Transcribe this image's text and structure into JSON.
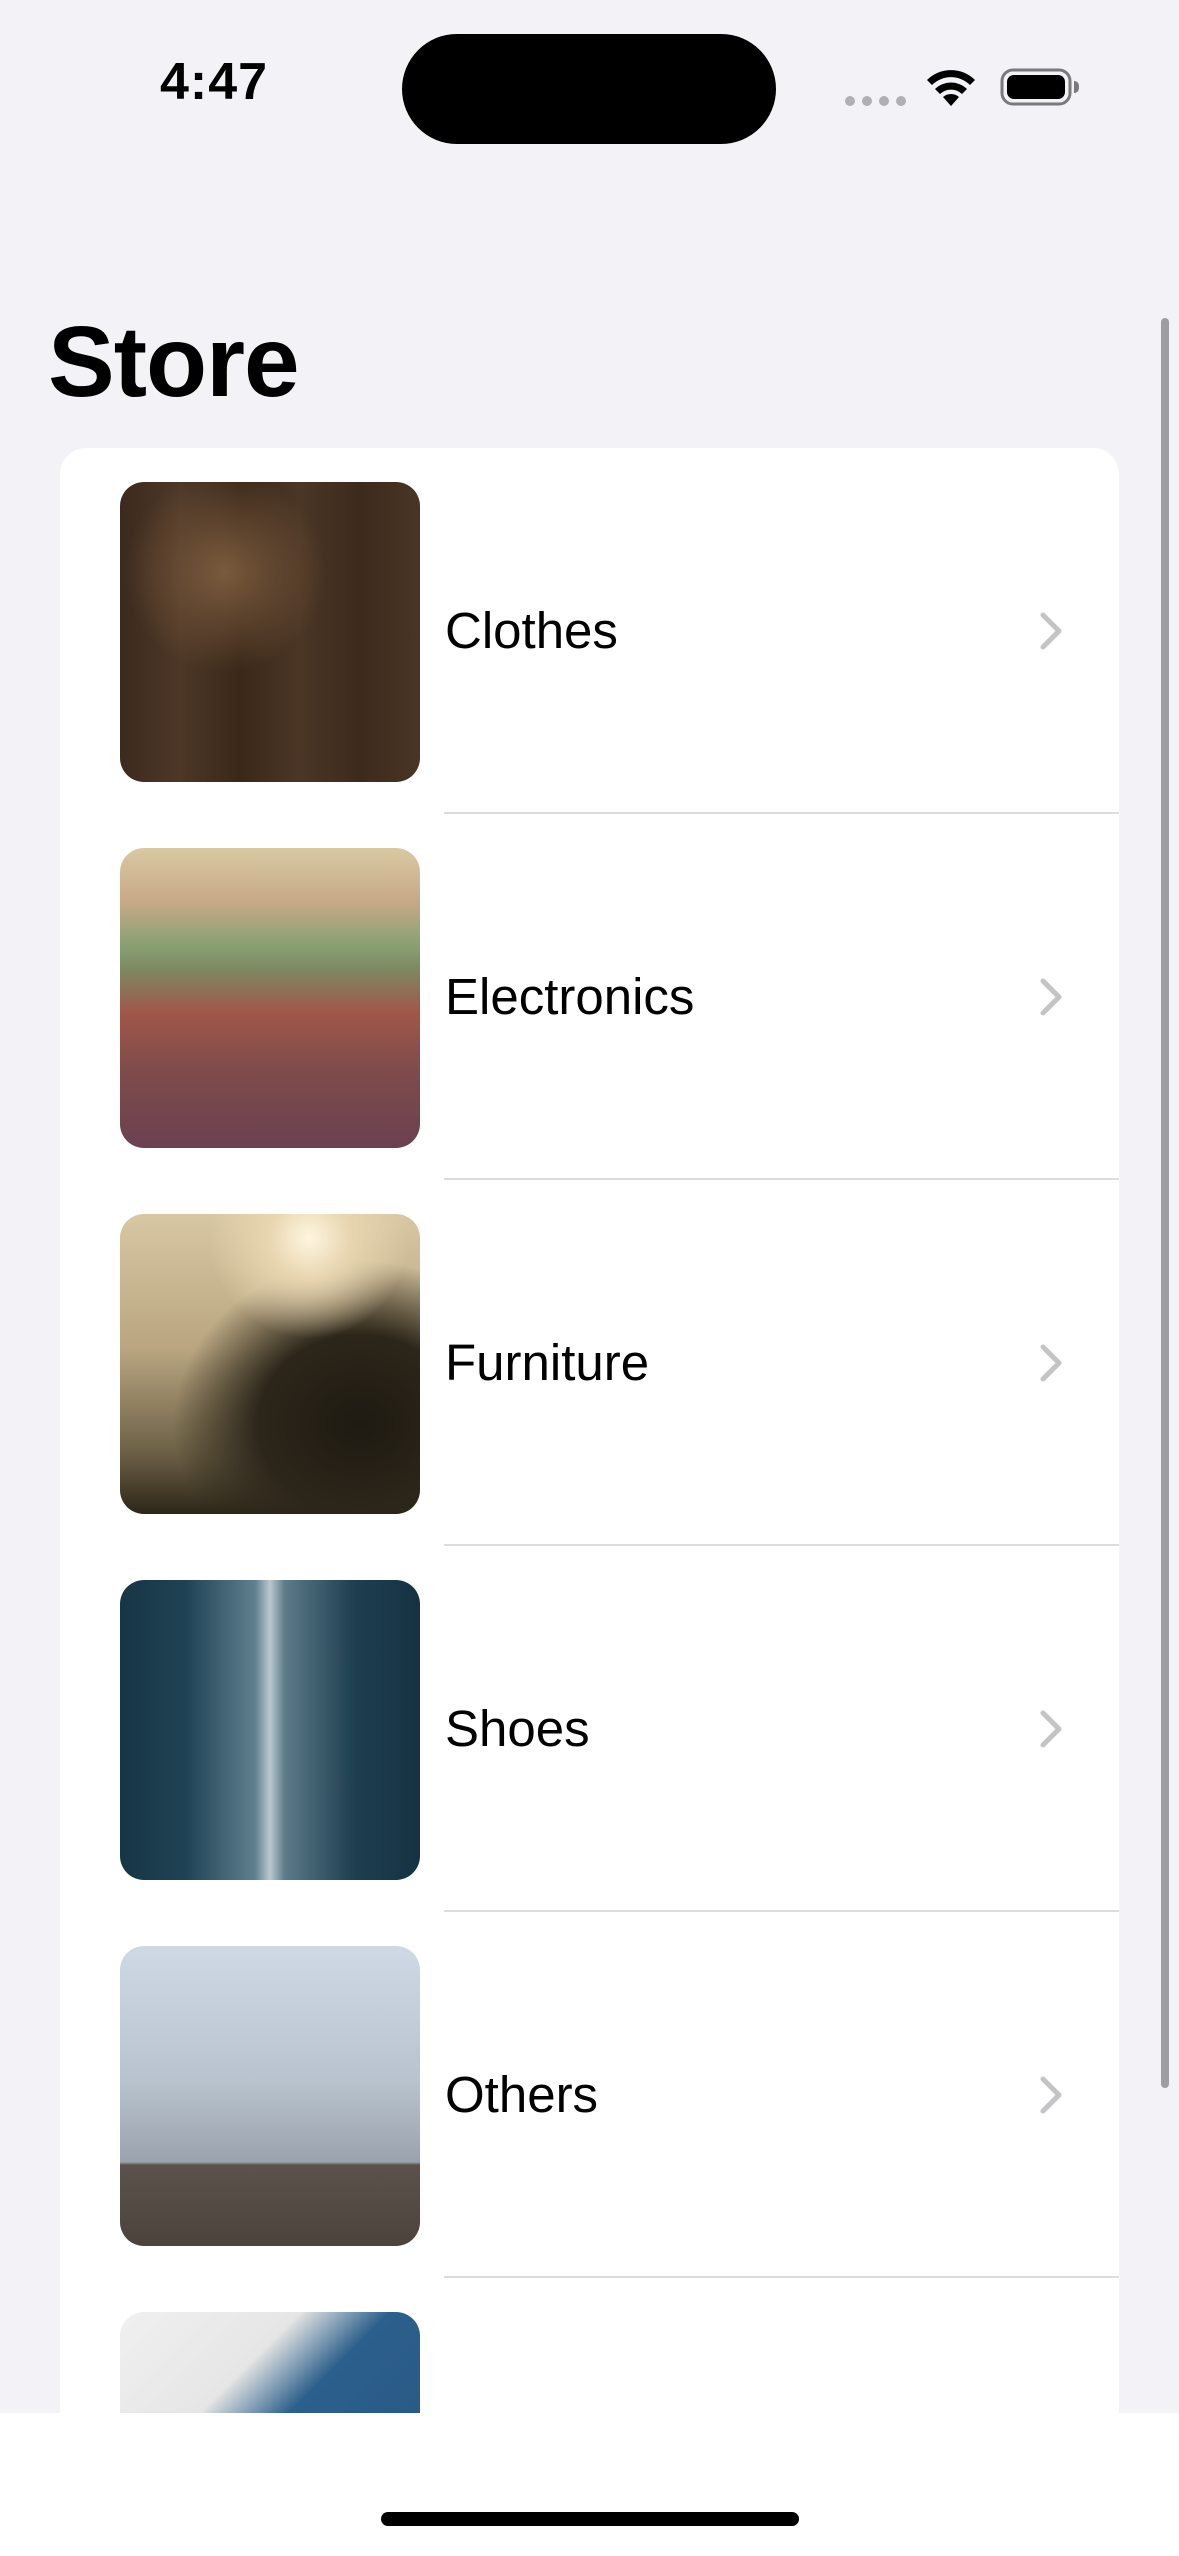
{
  "status_bar": {
    "time": "4:47",
    "icons": [
      "cellular-signal-icon",
      "wifi-icon",
      "battery-icon"
    ]
  },
  "page": {
    "title": "Store"
  },
  "categories": [
    {
      "label": "Clothes",
      "image": "tools-on-wood-photo"
    },
    {
      "label": "Electronics",
      "image": "autumn-leaves-path-photo"
    },
    {
      "label": "Furniture",
      "image": "foggy-tree-photo"
    },
    {
      "label": "Shoes",
      "image": "city-street-photo"
    },
    {
      "label": "Others",
      "image": "foggy-pier-photo"
    },
    {
      "label": "",
      "image": "laptop-person-photo"
    }
  ],
  "colors": {
    "background": "#f2f2f7",
    "card": "#ffffff",
    "chevron": "#c4c4c6",
    "divider": "#dcdce0"
  }
}
